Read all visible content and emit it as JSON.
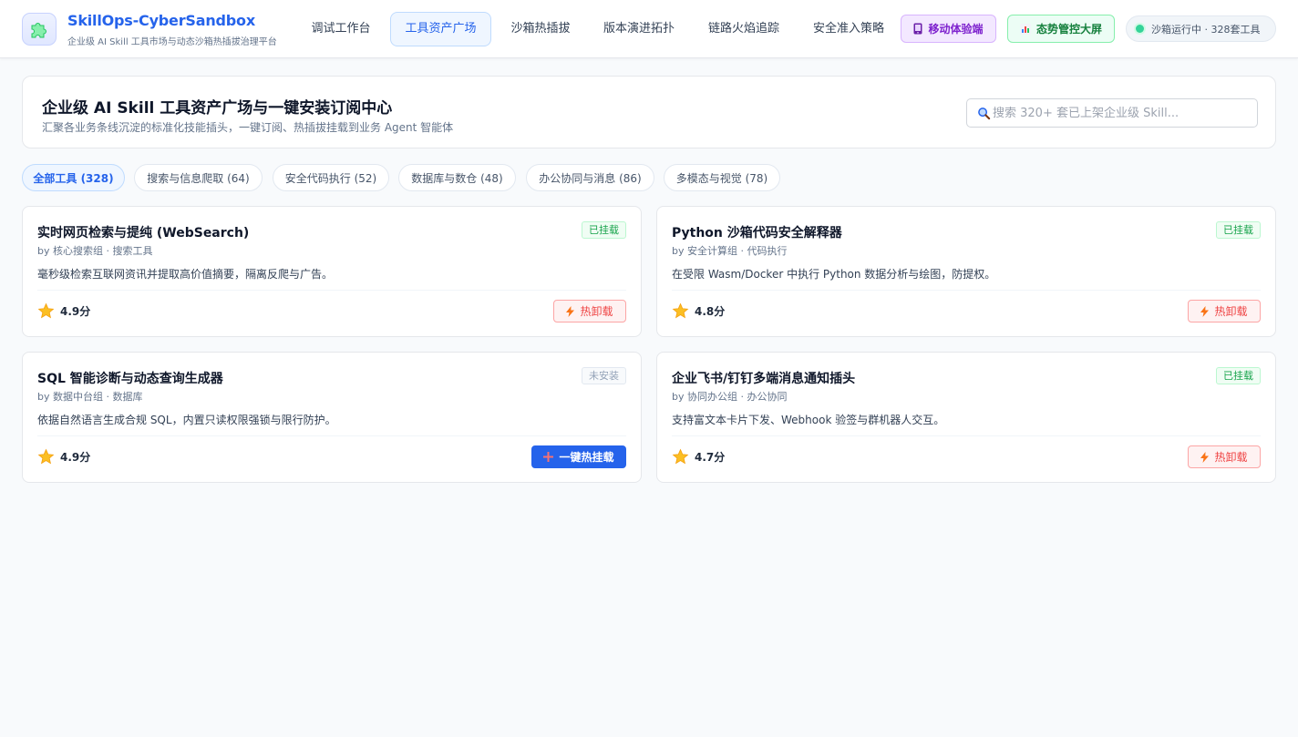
{
  "brand": {
    "title": "SkillOps-CyberSandbox",
    "subtitle": "企业级 AI Skill 工具市场与动态沙箱热插拔治理平台"
  },
  "nav": {
    "items": [
      {
        "label": "调试工作台",
        "active": false
      },
      {
        "label": "工具资产广场",
        "active": true
      },
      {
        "label": "沙箱热插拔",
        "active": false
      },
      {
        "label": "版本演进拓扑",
        "active": false
      },
      {
        "label": "链路火焰追踪",
        "active": false
      },
      {
        "label": "安全准入策略",
        "active": false
      }
    ],
    "mobile_label": "移动体验端",
    "screen_label": "态势管控大屏",
    "status_text": "沙箱运行中 · 328套工具"
  },
  "hero": {
    "title": "企业级 AI Skill 工具资产广场与一键安装订阅中心",
    "subtitle": "汇聚各业务条线沉淀的标准化技能插头，一键订阅、热插拔挂载到业务 Agent 智能体",
    "search_placeholder": "搜索 320+ 套已上架企业级 Skill..."
  },
  "filters": [
    {
      "label": "全部工具 (328)",
      "active": true
    },
    {
      "label": "搜索与信息爬取 (64)",
      "active": false
    },
    {
      "label": "安全代码执行 (52)",
      "active": false
    },
    {
      "label": "数据库与数仓 (48)",
      "active": false
    },
    {
      "label": "办公协同与消息 (86)",
      "active": false
    },
    {
      "label": "多模态与视觉 (78)",
      "active": false
    }
  ],
  "cards": [
    {
      "title": "实时网页检索与提纯 (WebSearch)",
      "meta": "by 核心搜索组 · 搜索工具",
      "desc": "毫秒级检索互联网资讯并提取高价值摘要，隔离反爬与广告。",
      "status": "已挂载",
      "rating": "4.9分",
      "action": "热卸载"
    },
    {
      "title": "Python 沙箱代码安全解释器",
      "meta": "by 安全计算组 · 代码执行",
      "desc": "在受限 Wasm/Docker 中执行 Python 数据分析与绘图，防提权。",
      "status": "已挂载",
      "rating": "4.8分",
      "action": "热卸载"
    },
    {
      "title": "SQL 智能诊断与动态查询生成器",
      "meta": "by 数据中台组 · 数据库",
      "desc": "依据自然语言生成合规 SQL，内置只读权限强锁与限行防护。",
      "status": "未安装",
      "rating": "4.9分",
      "action": "一键热挂载"
    },
    {
      "title": "企业飞书/钉钉多端消息通知插头",
      "meta": "by 协同办公组 · 办公协同",
      "desc": "支持富文本卡片下发、Webhook 验签与群机器人交互。",
      "status": "已挂载",
      "rating": "4.7分",
      "action": "热卸载"
    }
  ],
  "icons": {
    "logo": "puzzle-icon",
    "mobile": "phone-icon",
    "screen": "bar-chart-icon",
    "search": "search-icon",
    "rating": "star-icon",
    "unmount": "bolt-icon",
    "install": "plus-icon"
  },
  "colors": {
    "primary": "#2563eb",
    "success": "#16a34a",
    "danger": "#ef4444",
    "purple": "#7e22ce"
  }
}
